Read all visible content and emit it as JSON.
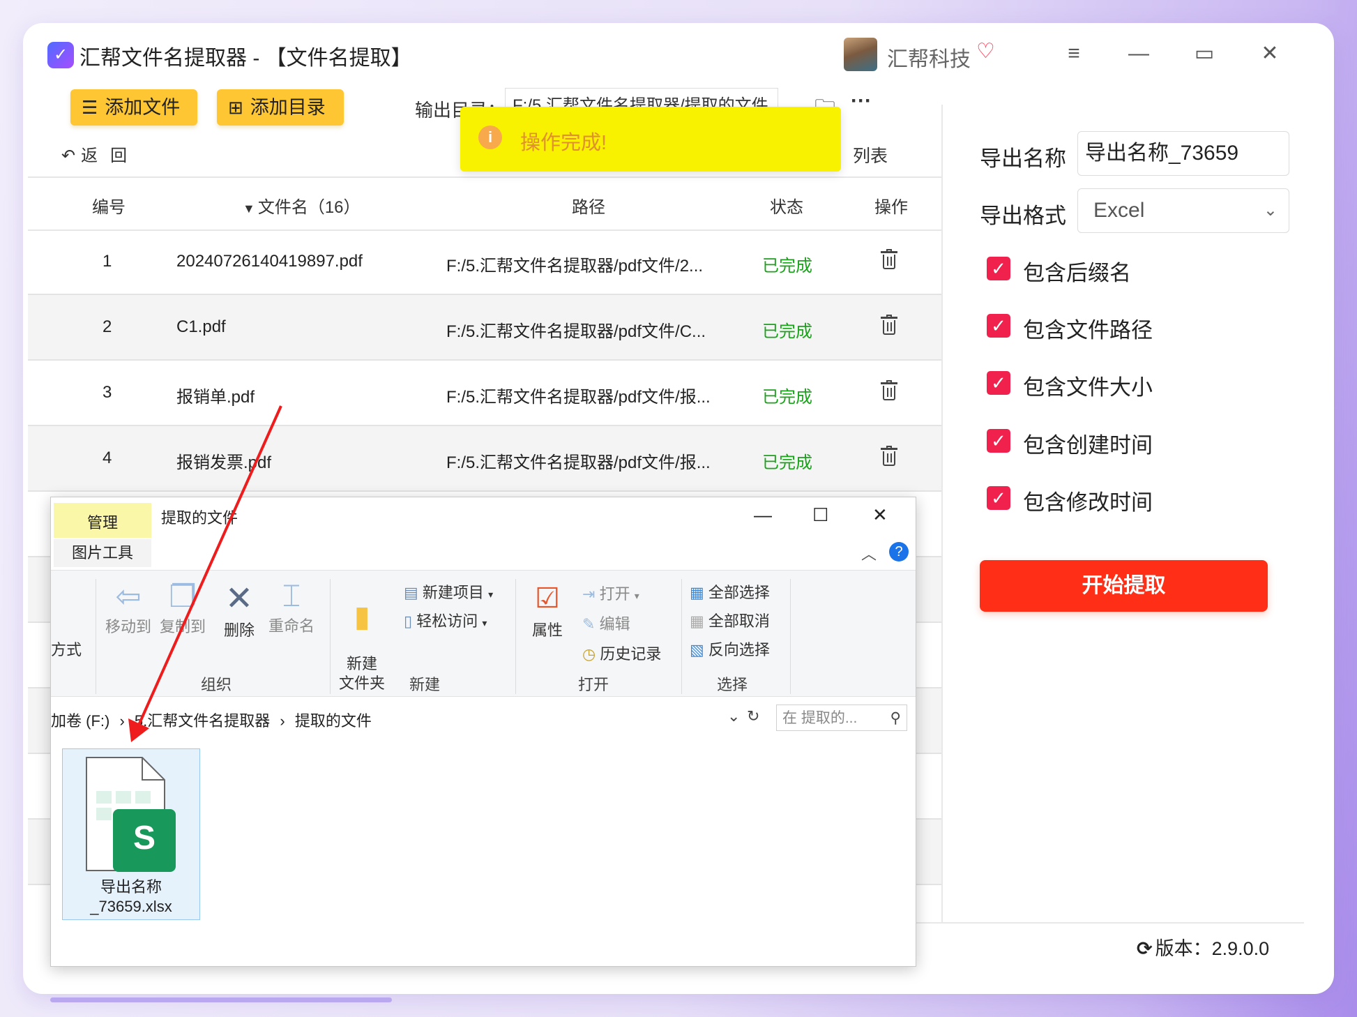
{
  "title_bar": {
    "app_title": "汇帮文件名提取器 - 【文件名提取】",
    "user_name": "汇帮科技"
  },
  "toolbar": {
    "add_file_label": "添加文件",
    "add_dir_label": "添加目录",
    "output_dir_label": "输出目录：",
    "output_dir_value": "F:/5.汇帮文件名提取器/提取的文件",
    "back_label": "返回",
    "list_label": "列表"
  },
  "toast": {
    "message": "操作完成!"
  },
  "table": {
    "headers": [
      "编号",
      "文件名（16）",
      "路径",
      "状态",
      "操作"
    ],
    "rows": [
      {
        "num": "1",
        "name": "20240726140419897.pdf",
        "path": "F:/5.汇帮文件名提取器/pdf文件/2...",
        "status": "已完成"
      },
      {
        "num": "2",
        "name": "C1.pdf",
        "path": "F:/5.汇帮文件名提取器/pdf文件/C...",
        "status": "已完成"
      },
      {
        "num": "3",
        "name": "报销单.pdf",
        "path": "F:/5.汇帮文件名提取器/pdf文件/报...",
        "status": "已完成"
      },
      {
        "num": "4",
        "name": "报销发票.pdf",
        "path": "F:/5.汇帮文件名提取器/pdf文件/报...",
        "status": "已完成"
      }
    ]
  },
  "right_panel": {
    "export_name_label": "导出名称",
    "export_name_value": "导出名称_73659",
    "export_format_label": "导出格式",
    "export_format_value": "Excel",
    "options": [
      {
        "label": "包含后缀名",
        "checked": true
      },
      {
        "label": "包含文件路径",
        "checked": true
      },
      {
        "label": "包含文件大小",
        "checked": true
      },
      {
        "label": "包含创建时间",
        "checked": true
      },
      {
        "label": "包含修改时间",
        "checked": true
      }
    ],
    "start_label": "开始提取",
    "version_text": "版本：2.9.0.0"
  },
  "explorer": {
    "tab_manage": "管理",
    "tab_picture_tools": "图片工具",
    "window_title": "提取的文件",
    "ribbon": {
      "partial_left": "方式",
      "move_to": "移动到",
      "copy_to": "复制到",
      "delete": "删除",
      "rename": "重命名",
      "group_organize": "组织",
      "new_folder": "新建\n文件夹",
      "new_item": "新建项目",
      "easy_access": "轻松访问",
      "group_new": "新建",
      "properties": "属性",
      "open": "打开",
      "edit": "编辑",
      "history": "历史记录",
      "group_open": "打开",
      "select_all": "全部选择",
      "select_none": "全部取消",
      "invert_selection": "反向选择",
      "group_select": "选择"
    },
    "address": {
      "crumb_1": "加卷 (F:)",
      "crumb_2": "5.汇帮文件名提取器",
      "crumb_3": "提取的文件",
      "search_placeholder": "在 提取的..."
    },
    "file": {
      "name": "导出名称\n_73659.xlsx",
      "badge": "S"
    }
  },
  "colors": {
    "accent_yellow": "#ffc633",
    "start_red": "#ff2e17",
    "checkbox_pink": "#f0214d",
    "status_green": "#1aa21a",
    "toast_yellow": "#f8f200",
    "arrow_red": "#ee1c1c"
  }
}
